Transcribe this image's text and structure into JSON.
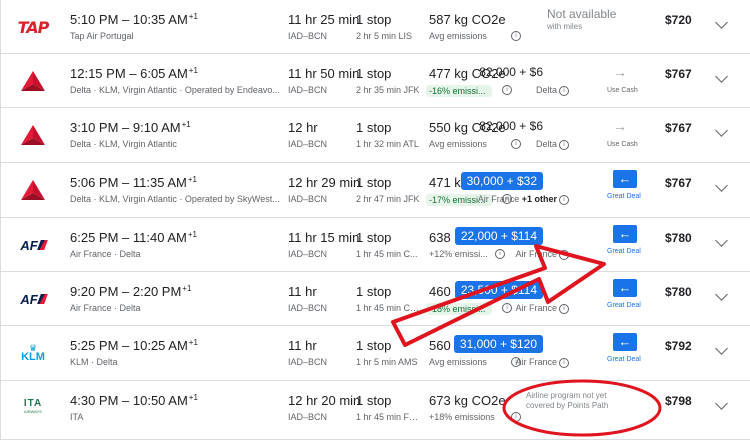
{
  "flights": [
    {
      "logo": "tap-air-portugal-logo",
      "times": "5:10 PM – 10:35 AM",
      "plus": "+1",
      "airline": "Tap Air Portugal",
      "duration": "11 hr 25 min",
      "route": "IAD–BCN",
      "stops": "1 stop",
      "stop_detail": "2 hr 5 min LIS",
      "co2": "587 kg CO2e",
      "emissions": "Avg emissions",
      "emissions_green": false,
      "miles": "",
      "program": "",
      "action": "not-available",
      "not_available": "Not available",
      "with_miles": "with miles",
      "price": "$720"
    },
    {
      "logo": "delta-logo",
      "times": "12:15 PM – 6:05 AM",
      "plus": "+1",
      "airline": "Delta · KLM, Virgin Atlantic · Operated by Endeavo...",
      "duration": "11 hr 50 min",
      "route": "IAD–BCN",
      "stops": "1 stop",
      "stop_detail": "2 hr 35 min JFK",
      "co2": "477 kg CO2e",
      "emissions": "-16% emissi...",
      "emissions_green": true,
      "miles": "82,000 + $6",
      "program": "Delta",
      "action": "use-cash",
      "action_label": "Use Cash",
      "price": "$767"
    },
    {
      "logo": "delta-logo",
      "times": "3:10 PM – 9:10 AM",
      "plus": "+1",
      "airline": "Delta · KLM, Virgin Atlantic",
      "duration": "12 hr",
      "route": "IAD–BCN",
      "stops": "1 stop",
      "stop_detail": "1 hr 32 min ATL",
      "co2": "550 kg CO2e",
      "emissions": "Avg emissions",
      "emissions_green": false,
      "miles": "82,000 + $6",
      "program": "Delta",
      "action": "use-cash",
      "action_label": "Use Cash",
      "price": "$767"
    },
    {
      "logo": "delta-logo",
      "times": "5:06 PM – 11:35 AM",
      "plus": "+1",
      "airline": "Delta · KLM, Virgin Atlantic · Operated by SkyWest...",
      "duration": "12 hr 29 min",
      "route": "IAD–BCN",
      "stops": "1 stop",
      "stop_detail": "2 hr 47 min JFK",
      "co2": "471 kg CO2e",
      "emissions": "-17% emissi...",
      "emissions_green": true,
      "miles": "30,000 + $32",
      "miles_badge": true,
      "program": "Air France",
      "program_extra": "+1 other",
      "action": "great-deal",
      "action_label": "Great Deal",
      "price": "$767"
    },
    {
      "logo": "air-france-logo",
      "times": "6:25 PM – 11:40 AM",
      "plus": "+1",
      "airline": "Air France · Delta",
      "duration": "11 hr 15 min",
      "route": "IAD–BCN",
      "stops": "1 stop",
      "stop_detail": "1 hr 45 min C...",
      "co2": "638 kg CO2e",
      "emissions": "+12% emissi...",
      "emissions_green": false,
      "miles": "22,000 + $114",
      "miles_badge": true,
      "program": "Air France",
      "action": "great-deal",
      "action_label": "Great Deal",
      "price": "$780"
    },
    {
      "logo": "air-france-logo",
      "times": "9:20 PM – 2:20 PM",
      "plus": "+1",
      "airline": "Air France · Delta",
      "duration": "11 hr",
      "route": "IAD–BCN",
      "stops": "1 stop",
      "stop_detail": "1 hr 45 min CD...",
      "co2": "460 kg CO2e",
      "emissions": "-18% emissi...",
      "emissions_green": true,
      "miles": "23,500 + $114",
      "miles_badge": true,
      "program": "Air France",
      "action": "great-deal",
      "action_label": "Great Deal",
      "price": "$780"
    },
    {
      "logo": "klm-logo",
      "times": "5:25 PM – 10:25 AM",
      "plus": "+1",
      "airline": "KLM · Delta",
      "duration": "11 hr",
      "route": "IAD–BCN",
      "stops": "1 stop",
      "stop_detail": "1 hr 5 min AMS",
      "co2": "560 kg CO2e",
      "emissions": "Avg emissions",
      "emissions_green": false,
      "miles": "31,000 + $120",
      "miles_badge": true,
      "program": "Air France",
      "action": "great-deal",
      "action_label": "Great Deal",
      "price": "$792"
    },
    {
      "logo": "ita-airways-logo",
      "times": "4:30 PM – 10:50 AM",
      "plus": "+1",
      "airline": "ITA",
      "duration": "12 hr 20 min",
      "route": "IAD–BCN",
      "stops": "1 stop",
      "stop_detail": "1 hr 45 min FCO",
      "co2": "673 kg CO2e",
      "emissions": "+18% emissions",
      "emissions_green": false,
      "miles": "",
      "program": "",
      "action": "not-supported",
      "note_line1": "Airline program not yet",
      "note_line2": "covered by Points Path",
      "price": "$798"
    }
  ],
  "logos": {
    "tap": "TAP",
    "af": "AF",
    "klm": "KLM",
    "ita": "ITA",
    "ita_sub": "AIRWAYS"
  },
  "colors": {
    "accent": "#1a73e8",
    "annotation": "#e0141e",
    "green_bg": "#e6f4ea",
    "green_text": "#137333",
    "delta_red": "#c8102e"
  }
}
